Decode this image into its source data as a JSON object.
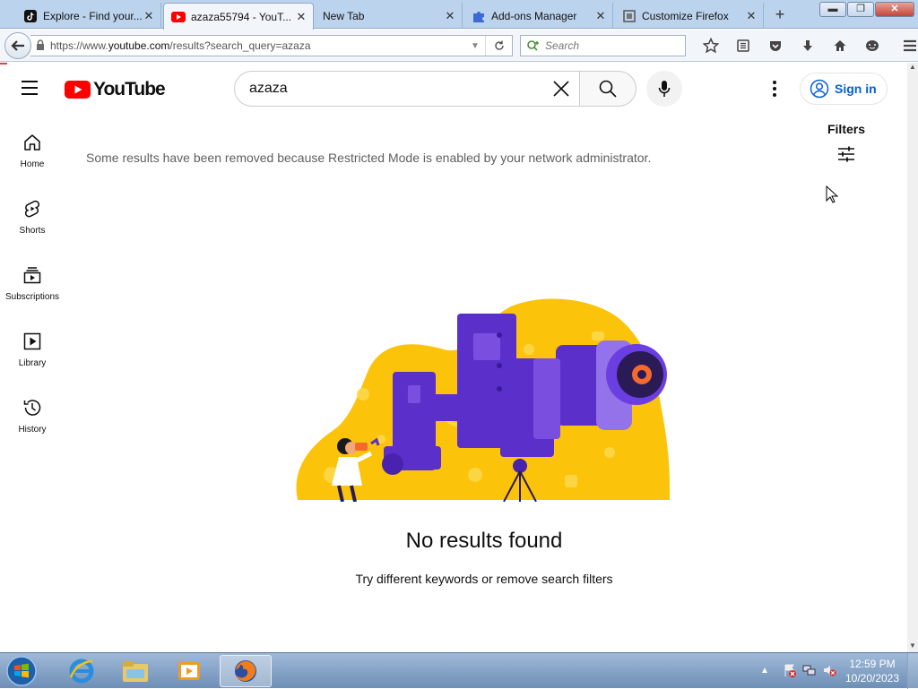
{
  "browser": {
    "tabs": [
      {
        "label": "Explore - Find your...",
        "icon": "tiktok-icon",
        "active": false
      },
      {
        "label": "azaza55794 - YouT...",
        "icon": "youtube-icon",
        "active": true
      },
      {
        "label": "New Tab",
        "icon": "",
        "active": false
      },
      {
        "label": "Add-ons Manager",
        "icon": "puzzle-icon",
        "active": false
      },
      {
        "label": "Customize Firefox",
        "icon": "customize-icon",
        "active": false
      }
    ],
    "new_tab": "+",
    "window_buttons": {
      "minimize": "▬",
      "maximize": "❐",
      "close": "✕"
    },
    "url_prefix": "https://www.",
    "url_host": "youtube.com",
    "url_path": "/results?search_query=azaza",
    "search_placeholder": "Search"
  },
  "youtube": {
    "logo_text": "YouTube",
    "search_query": "azaza",
    "signin_label": "Sign in",
    "brand_color": "#ff0000",
    "link_color": "#065fd4"
  },
  "sidebar": {
    "items": [
      {
        "label": "Home",
        "icon": "home-icon"
      },
      {
        "label": "Shorts",
        "icon": "shorts-icon"
      },
      {
        "label": "Subscriptions",
        "icon": "subscriptions-icon"
      },
      {
        "label": "Library",
        "icon": "library-icon"
      },
      {
        "label": "History",
        "icon": "history-icon"
      }
    ]
  },
  "main": {
    "restricted_notice": "Some results have been removed because Restricted Mode is enabled by your network administrator.",
    "filters_label": "Filters",
    "no_results_title": "No results found",
    "no_results_hint": "Try different keywords or remove search filters"
  },
  "taskbar": {
    "apps": [
      {
        "name": "ie-icon",
        "active": false
      },
      {
        "name": "explorer-icon",
        "active": false
      },
      {
        "name": "media-player-icon",
        "active": false
      },
      {
        "name": "firefox-icon",
        "active": true
      }
    ],
    "time": "12:59 PM",
    "date": "10/20/2023"
  }
}
